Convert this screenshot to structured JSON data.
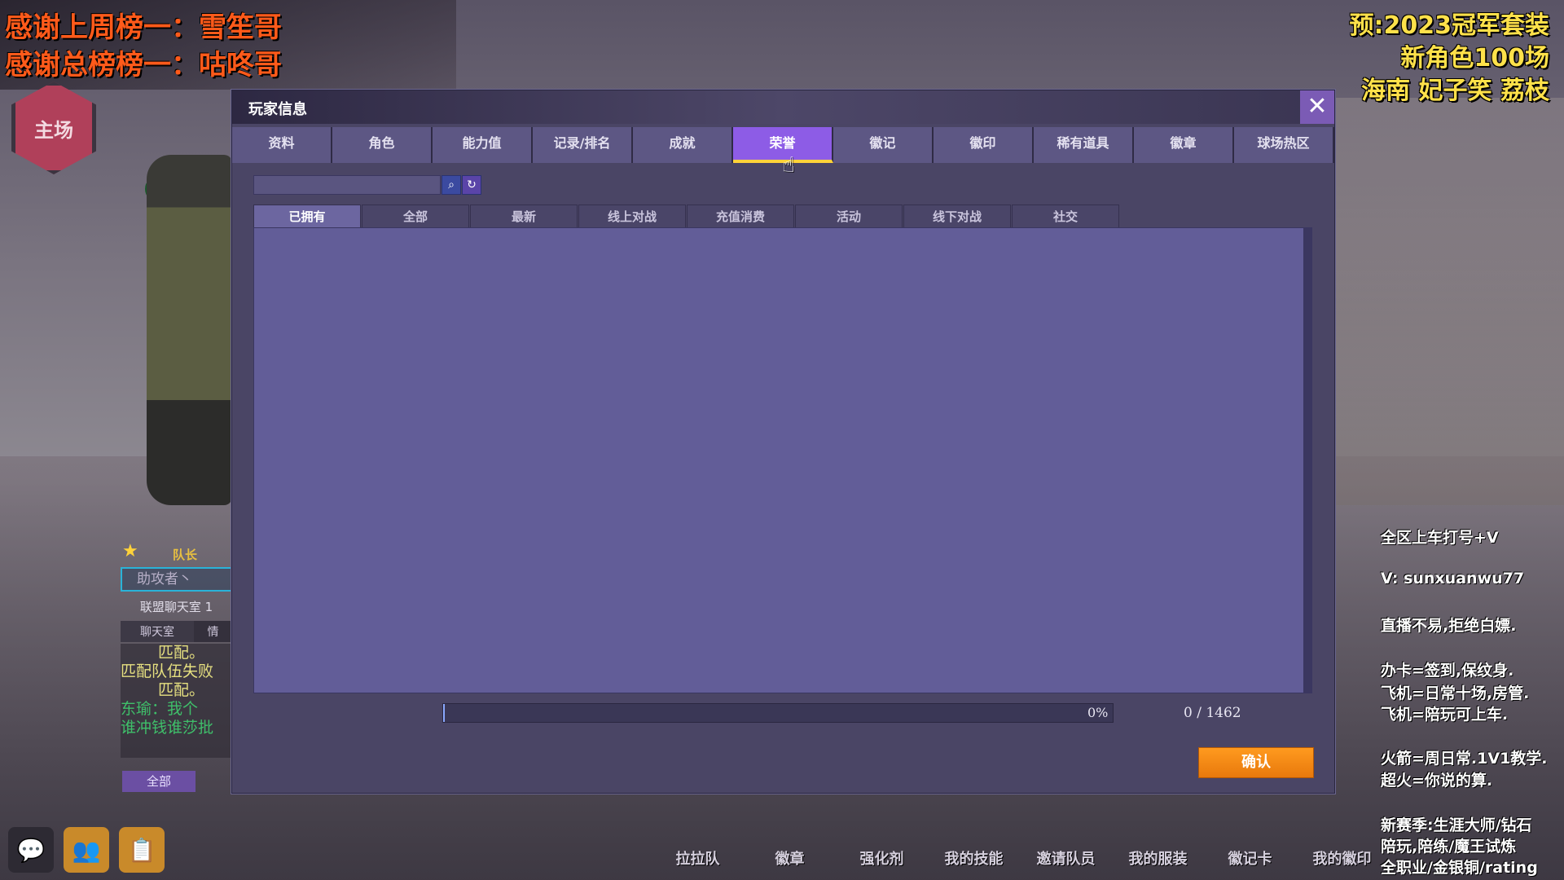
{
  "overlays": {
    "top_left": [
      "感谢上周榜一：雪笙哥",
      "感谢总榜榜一：咕咚哥"
    ],
    "top_right": [
      "预:2023冠军套装",
      "新角色100场",
      "海南 妃子笑 荔枝"
    ],
    "right_notes": [
      "全区上车打号+V",
      "V: sunxuanwu77",
      "直播不易,拒绝白嫖.",
      "办卡=签到,保纹身.",
      "飞机=日常十场,房管.",
      "飞机=陪玩可上车.",
      "火箭=周日常.1V1教学.",
      "超火=你说的算.",
      "新赛季:生涯大师/钻石",
      "陪玩,陪练/魔王试炼",
      "全职业/金银铜/rating"
    ]
  },
  "home_badge": "主场",
  "left_panel": {
    "leader_label": "队长",
    "name": "助攻者丶",
    "chat_room": "联盟聊天室 1",
    "chat_tabs": [
      "聊天室",
      "情"
    ],
    "chat_lines": [
      "匹配。",
      "匹配队伍失败",
      "匹配。",
      "东瑜：我个",
      "谁冲钱谁莎批"
    ],
    "chat_filter": "全部"
  },
  "bottom_menu": [
    "拉拉队",
    "徽章",
    "强化剂",
    "我的技能",
    "邀请队员",
    "我的服装",
    "徽记卡",
    "我的徽印"
  ],
  "dialog": {
    "title": "玩家信息",
    "tabs": [
      "资料",
      "角色",
      "能力值",
      "记录/排名",
      "成就",
      "荣誉",
      "徽记",
      "徽印",
      "稀有道具",
      "徽章",
      "球场热区"
    ],
    "active_tab": "荣誉",
    "search": {
      "value": ""
    },
    "subtabs": [
      "已拥有",
      "全部",
      "最新",
      "线上对战",
      "充值消费",
      "活动",
      "线下对战",
      "社交"
    ],
    "active_subtab": "已拥有",
    "progress": {
      "percent_label": "0%",
      "fraction": 0,
      "count": "0 / 1462"
    },
    "confirm_label": "确认"
  },
  "colors": {
    "dialog_bg": "#4a4565",
    "tab_active": "#8d5ce6",
    "tab_underline": "#ffd23a",
    "content_bg": "#625d98",
    "confirm": "#ff9a1f"
  }
}
